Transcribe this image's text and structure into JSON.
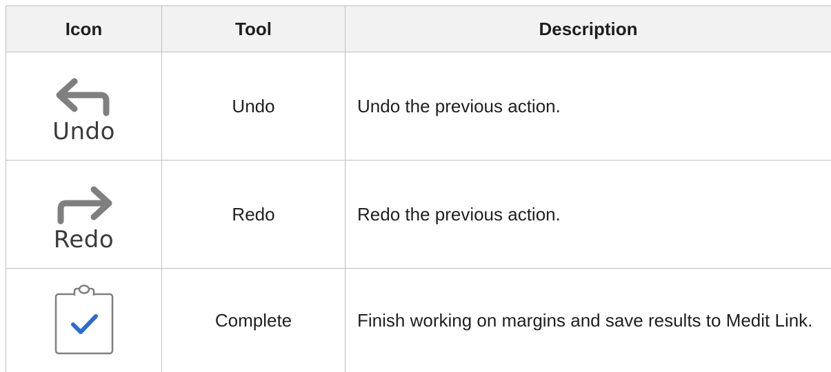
{
  "table": {
    "headers": {
      "icon": "Icon",
      "tool": "Tool",
      "description": "Description"
    },
    "rows": [
      {
        "icon": "undo-arrow-icon",
        "icon_caption": "Undo",
        "tool": "Undo",
        "description": "Undo the previous action."
      },
      {
        "icon": "redo-arrow-icon",
        "icon_caption": "Redo",
        "tool": "Redo",
        "description": "Redo the previous action."
      },
      {
        "icon": "clipboard-check-icon",
        "tool": "Complete",
        "description": "Finish working on margins and save results to Medit Link."
      }
    ]
  },
  "colors": {
    "border": "#bfbfbf",
    "header_bg": "#f2f2f2",
    "icon_gray": "#7f7f7f",
    "check_blue": "#2e6ad1"
  }
}
